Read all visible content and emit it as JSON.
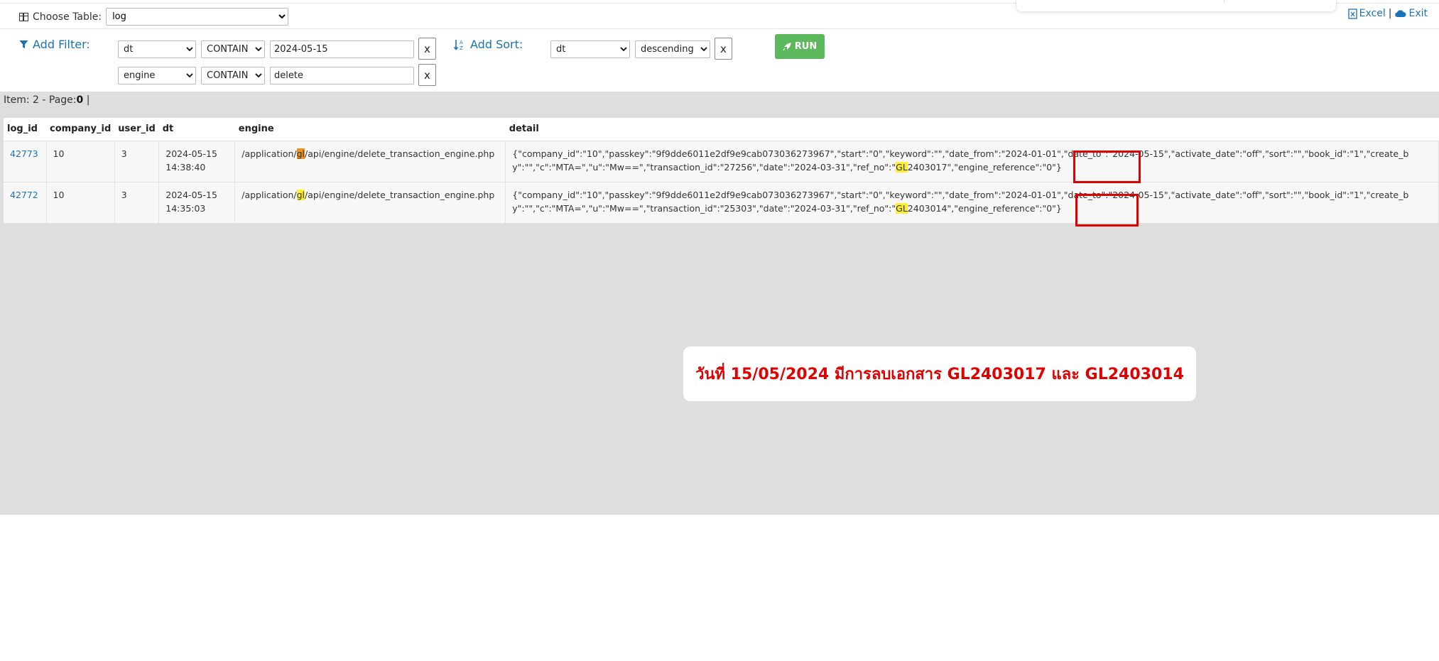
{
  "header": {
    "choose_table_label": "Choose Table:",
    "table_value": "log",
    "excel_label": "Excel",
    "exit_label": "Exit",
    "separator": "|"
  },
  "filters": {
    "add_filter_label": "Add Filter:",
    "rows": [
      {
        "field": "dt",
        "op": "CONTAIN",
        "value": "2024-05-15",
        "remove": "x"
      },
      {
        "field": "engine",
        "op": "CONTAIN",
        "value": "delete",
        "remove": "x"
      }
    ]
  },
  "sort": {
    "add_sort_label": "Add Sort:",
    "field": "dt",
    "order": "descending",
    "remove": "x"
  },
  "run_label": "RUN",
  "item_info": {
    "prefix": "Item: 2 - Page:",
    "page": "0",
    "suffix": "|"
  },
  "table": {
    "columns": [
      "log_id",
      "company_id",
      "user_id",
      "dt",
      "engine",
      "detail"
    ],
    "rows": [
      {
        "log_id": "42773",
        "company_id": "10",
        "user_id": "3",
        "dt_date": "2024-05-15",
        "dt_time": "14:38:40",
        "engine_pre": "/application/",
        "engine_hl": "gl",
        "engine_post": "/api/engine/delete_transaction_engine.php",
        "detail_pre": "{\"company_id\":\"10\",\"passkey\":\"9f9dde6011e2df9e9cab073036273967\",\"start\":\"0\",\"keyword\":\"\",\"date_from\":\"2024-01-01\",\"date_to\":\"2024-05-15\",\"activate_date\":\"off\",\"sort\":\"\",\"book_id\":\"1\",\"create_by\":\"\",\"c\":\"MTA=\",\"u\":\"Mw==\",\"transaction_id\":\"27256\",\"date\":\"2024-03-31\",\"ref_no\":\"",
        "detail_hl": "GL",
        "detail_post": "2403017\",\"engine_reference\":\"0\"}"
      },
      {
        "log_id": "42772",
        "company_id": "10",
        "user_id": "3",
        "dt_date": "2024-05-15",
        "dt_time": "14:35:03",
        "engine_pre": "/application/",
        "engine_hl": "gl",
        "engine_post": "/api/engine/delete_transaction_engine.php",
        "detail_pre": "{\"company_id\":\"10\",\"passkey\":\"9f9dde6011e2df9e9cab073036273967\",\"start\":\"0\",\"keyword\":\"\",\"date_from\":\"2024-01-01\",\"date_to\":\"2024-05-15\",\"activate_date\":\"off\",\"sort\":\"\",\"book_id\":\"1\",\"create_by\":\"\",\"c\":\"MTA=\",\"u\":\"Mw==\",\"transaction_id\":\"25303\",\"date\":\"2024-03-31\",\"ref_no\":\"",
        "detail_hl": "GL",
        "detail_post": "2403014\",\"engine_reference\":\"0\"}"
      }
    ]
  },
  "callout_text": "วันที่ 15/05/2024 มีการลบเอกสาร GL2403017 และ GL2403014",
  "colors": {
    "link": "#1a73b8",
    "run": "#5cb85c",
    "annotation": "#e00000"
  }
}
